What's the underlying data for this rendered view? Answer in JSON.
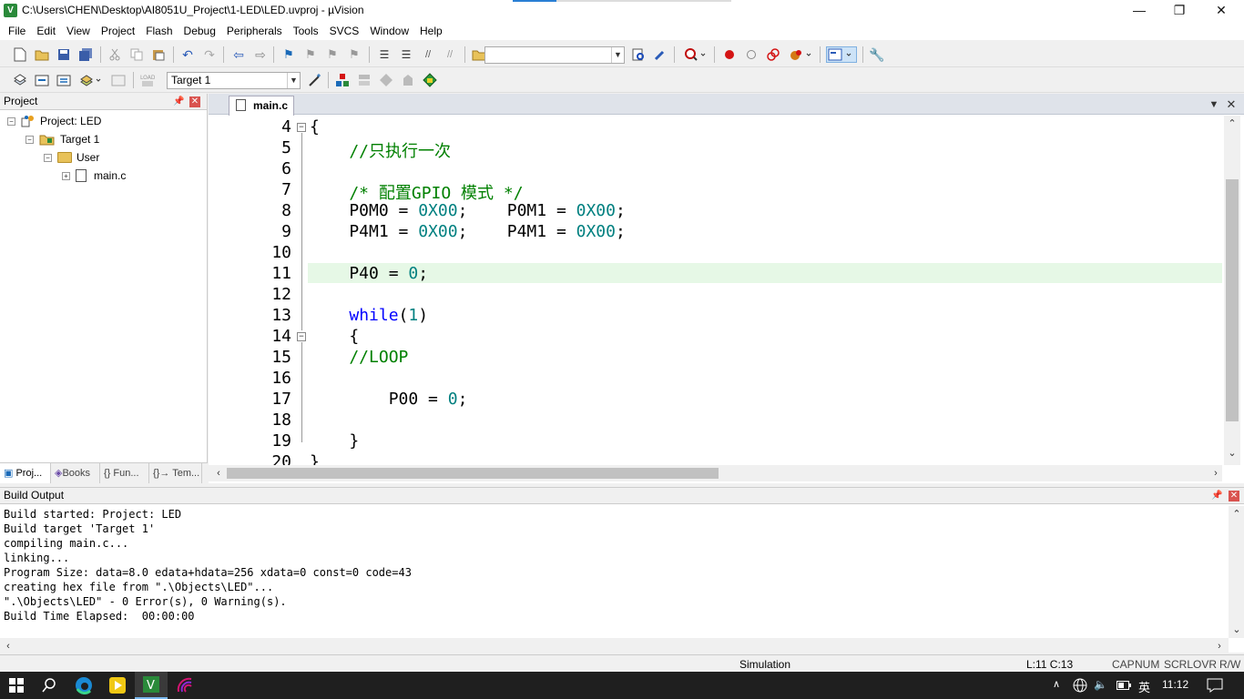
{
  "window": {
    "title": "C:\\Users\\CHEN\\Desktop\\AI8051U_Project\\1-LED\\LED.uvproj - µVision",
    "minimize": "—",
    "restore": "❐",
    "close": "✕"
  },
  "menu": [
    "File",
    "Edit",
    "View",
    "Project",
    "Flash",
    "Debug",
    "Peripherals",
    "Tools",
    "SVCS",
    "Window",
    "Help"
  ],
  "toolbar2": {
    "target": "Target 1"
  },
  "project_panel": {
    "title": "Project",
    "tree": [
      {
        "label": "Project: LED",
        "level": 0
      },
      {
        "label": "Target 1",
        "level": 1
      },
      {
        "label": "User",
        "level": 2
      },
      {
        "label": "main.c",
        "level": 3
      }
    ],
    "tabs": [
      "Proj...",
      "Books",
      "{} Fun...",
      "{}→ Tem..."
    ]
  },
  "editor": {
    "tab": "main.c",
    "lines": [
      {
        "n": "4",
        "code": "{"
      },
      {
        "n": "5",
        "code": "    //只执行一次"
      },
      {
        "n": "6",
        "code": ""
      },
      {
        "n": "7",
        "code": "    /* 配置GPIO 模式 */"
      },
      {
        "n": "8",
        "code": "    P0M0 = 0X00;    P0M1 = 0X00;"
      },
      {
        "n": "9",
        "code": "    P4M1 = 0X00;    P4M1 = 0X00;"
      },
      {
        "n": "10",
        "code": ""
      },
      {
        "n": "11",
        "code": "    P40 = 0;"
      },
      {
        "n": "12",
        "code": ""
      },
      {
        "n": "13",
        "code": "    while(1)"
      },
      {
        "n": "14",
        "code": "    {"
      },
      {
        "n": "15",
        "code": "    //LOOP"
      },
      {
        "n": "16",
        "code": ""
      },
      {
        "n": "17",
        "code": "        P00 = 0;"
      },
      {
        "n": "18",
        "code": ""
      },
      {
        "n": "19",
        "code": "    }"
      },
      {
        "n": "20",
        "code": "}"
      }
    ]
  },
  "build_output": {
    "title": "Build Output",
    "lines": [
      "Build started: Project: LED",
      "Build target 'Target 1'",
      "compiling main.c...",
      "linking...",
      "Program Size: data=8.0 edata+hdata=256 xdata=0 const=0 code=43",
      "creating hex file from \".\\Objects\\LED\"...",
      "\".\\Objects\\LED\" - 0 Error(s), 0 Warning(s).",
      "Build Time Elapsed:  00:00:00"
    ]
  },
  "status": {
    "mode": "Simulation",
    "cursor": "L:11 C:13",
    "cap": "CAP",
    "num": "NUM",
    "scrl": "SCRL",
    "ovr": "OVR",
    "rw": "R/W"
  },
  "taskbar": {
    "time": "11:12",
    "ime": "英"
  }
}
